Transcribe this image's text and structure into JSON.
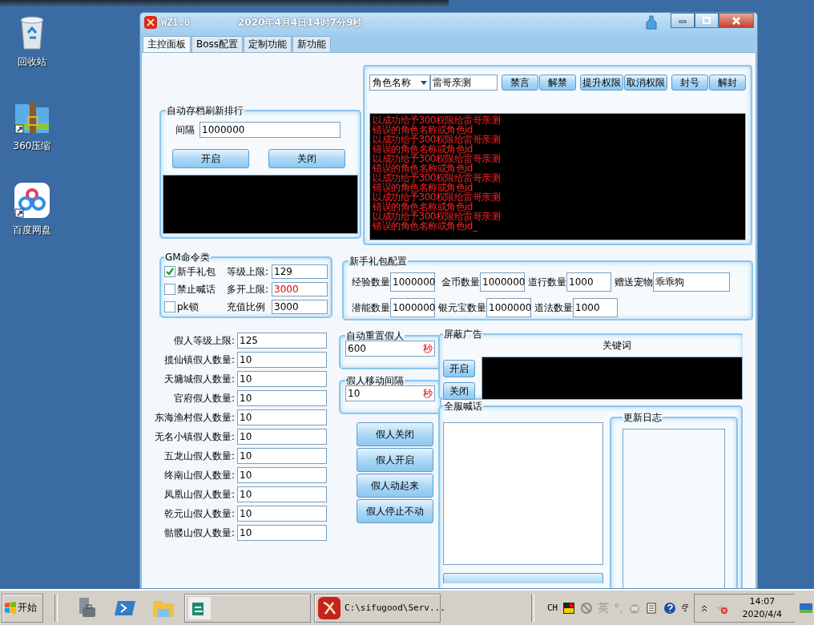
{
  "desktop_icons": [
    {
      "label": "回收站",
      "kind": "recycle"
    },
    {
      "label": "360压缩",
      "kind": "archive"
    },
    {
      "label": "百度网盘",
      "kind": "cloud"
    }
  ],
  "window": {
    "title": "WZ1.0",
    "clock": "2020年4月4日14时7分9秒"
  },
  "tabs": [
    {
      "label": "主控面板",
      "selected": true
    },
    {
      "label": "Boss配置",
      "selected": false
    },
    {
      "label": "定制功能",
      "selected": false
    },
    {
      "label": "新功能",
      "selected": false
    }
  ],
  "autosave": {
    "title": "自动存档刷新排行",
    "interval_label": "间隔",
    "interval": "1000000",
    "buttons": [
      "开启",
      "关闭"
    ]
  },
  "player_tools": {
    "field_type": "角色名称",
    "name": "雷哥亲测",
    "button_groups": [
      [
        "禁言",
        "解禁"
      ],
      [
        "提升权限",
        "取消权限"
      ],
      [
        "封号",
        "解封"
      ]
    ],
    "log": [
      "以成功给予300权限给雷哥亲测",
      "错误的角色名称或角色id",
      "以成功给予300权限给雷哥亲测",
      "错误的角色名称或角色id",
      "以成功给予300权限给雷哥亲测",
      "错误的角色名称或角色id",
      "以成功给予300权限给雷哥亲测",
      "错误的角色名称或角色id",
      "以成功给予300权限给雷哥亲测",
      "错误的角色名称或角色id",
      "以成功给予300权限给雷哥亲测",
      "错误的角色名称或角色id_"
    ]
  },
  "gm_commands": {
    "title": "GM命令类",
    "options": [
      {
        "label": "新手礼包",
        "checked": true,
        "setting": "等级上限:",
        "value": "129",
        "warning": false
      },
      {
        "label": "禁止喊话",
        "checked": false,
        "setting": "多开上限:",
        "value": "3000",
        "warning": true
      },
      {
        "label": "pk锁",
        "checked": false,
        "setting": "充值比例",
        "value": "3000",
        "warning": false
      }
    ]
  },
  "starter_pack": {
    "title": "新手礼包配置",
    "rows": [
      [
        {
          "label": "经验数量",
          "value": "1000000",
          "wide": false
        },
        {
          "label": "金币数量",
          "value": "1000000",
          "wide": false
        },
        {
          "label": "道行数量",
          "value": "1000",
          "wide": false
        },
        {
          "label": "赠送宠物",
          "value": "乖乖狗",
          "wide": true
        }
      ],
      [
        {
          "label": "潜能数量",
          "value": "1000000",
          "wide": false
        },
        {
          "label": "银元宝数量",
          "value": "1000000",
          "wide": false
        },
        {
          "label": "道法数量",
          "value": "1000",
          "wide": false
        }
      ]
    ]
  },
  "bots": [
    {
      "label": "假人等级上限:",
      "value": "125"
    },
    {
      "label": "揽仙镇假人数量:",
      "value": "10"
    },
    {
      "label": "天墉城假人数量:",
      "value": "10"
    },
    {
      "label": "官府假人数量:",
      "value": "10"
    },
    {
      "label": "东海渔村假人数量:",
      "value": "10"
    },
    {
      "label": "无名小镇假人数量:",
      "value": "10"
    },
    {
      "label": "五龙山假人数量:",
      "value": "10"
    },
    {
      "label": "终南山假人数量:",
      "value": "10"
    },
    {
      "label": "凤凰山假人数量:",
      "value": "10"
    },
    {
      "label": "乾元山假人数量:",
      "value": "10"
    },
    {
      "label": "骷髅山假人数量:",
      "value": "10"
    }
  ],
  "timers": [
    {
      "title": "自动重置假人",
      "value": "600",
      "unit": "秒"
    },
    {
      "title": "假人移动间隔",
      "value": "10",
      "unit": "秒"
    }
  ],
  "bot_buttons": [
    "假人关闭",
    "假人开启",
    "假人动起来",
    "假人停止不动"
  ],
  "ad_block": {
    "title": "屏蔽广告",
    "column": "关键词",
    "buttons": [
      "开启",
      "关闭"
    ]
  },
  "broadcast": {
    "title": "全服喊话"
  },
  "changelog": {
    "title": "更新日志"
  },
  "taskbar": {
    "start": "开始",
    "tasks": [
      {
        "kind": "easy"
      },
      {
        "kind": "game",
        "label": "C:\\sifugood\\Serv..."
      }
    ],
    "ime": "CH",
    "lang": "英",
    "punct": "°,",
    "time": "14:07",
    "date": "2020/4/4"
  }
}
